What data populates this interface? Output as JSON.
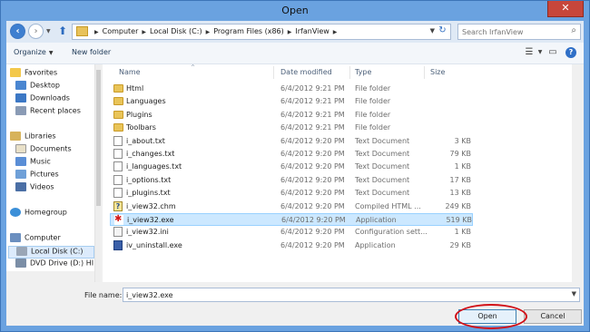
{
  "window": {
    "title": "Open",
    "close_glyph": "✕"
  },
  "address": {
    "crumbs": [
      "Computer",
      "Local Disk (C:)",
      "Program Files (x86)",
      "IrfanView"
    ],
    "search_placeholder": "Search IrfanView"
  },
  "toolbar": {
    "organize_label": "Organize",
    "new_folder_label": "New folder"
  },
  "nav": {
    "favorites": {
      "label": "Favorites",
      "items": [
        "Desktop",
        "Downloads",
        "Recent places"
      ]
    },
    "libraries": {
      "label": "Libraries",
      "items": [
        "Documents",
        "Music",
        "Pictures",
        "Videos"
      ]
    },
    "homegroup": {
      "label": "Homegroup"
    },
    "computer": {
      "label": "Computer",
      "items": [
        "Local Disk (C:)",
        "DVD Drive (D:) HI"
      ]
    }
  },
  "columns": {
    "name": "Name",
    "date": "Date modified",
    "type": "Type",
    "size": "Size"
  },
  "files": [
    {
      "name": "Html",
      "date": "6/4/2012 9:21 PM",
      "type": "File folder",
      "size": "",
      "icon": "folder-icon"
    },
    {
      "name": "Languages",
      "date": "6/4/2012 9:21 PM",
      "type": "File folder",
      "size": "",
      "icon": "folder-icon"
    },
    {
      "name": "Plugins",
      "date": "6/4/2012 9:21 PM",
      "type": "File folder",
      "size": "",
      "icon": "folder-icon"
    },
    {
      "name": "Toolbars",
      "date": "6/4/2012 9:21 PM",
      "type": "File folder",
      "size": "",
      "icon": "folder-icon"
    },
    {
      "name": "i_about.txt",
      "date": "6/4/2012 9:20 PM",
      "type": "Text Document",
      "size": "3 KB",
      "icon": "text-file-icon"
    },
    {
      "name": "i_changes.txt",
      "date": "6/4/2012 9:20 PM",
      "type": "Text Document",
      "size": "79 KB",
      "icon": "text-file-icon"
    },
    {
      "name": "i_languages.txt",
      "date": "6/4/2012 9:20 PM",
      "type": "Text Document",
      "size": "1 KB",
      "icon": "text-file-icon"
    },
    {
      "name": "i_options.txt",
      "date": "6/4/2012 9:20 PM",
      "type": "Text Document",
      "size": "17 KB",
      "icon": "text-file-icon"
    },
    {
      "name": "i_plugins.txt",
      "date": "6/4/2012 9:20 PM",
      "type": "Text Document",
      "size": "13 KB",
      "icon": "text-file-icon"
    },
    {
      "name": "i_view32.chm",
      "date": "6/4/2012 9:20 PM",
      "type": "Compiled HTML ...",
      "size": "249 KB",
      "icon": "help-file-icon"
    },
    {
      "name": "i_view32.exe",
      "date": "6/4/2012 9:20 PM",
      "type": "Application",
      "size": "519 KB",
      "icon": "irfanview-app-icon",
      "selected": true
    },
    {
      "name": "i_view32.ini",
      "date": "6/4/2012 9:20 PM",
      "type": "Configuration sett...",
      "size": "1 KB",
      "icon": "config-file-icon"
    },
    {
      "name": "iv_uninstall.exe",
      "date": "6/4/2012 9:20 PM",
      "type": "Application",
      "size": "29 KB",
      "icon": "uninstall-app-icon"
    }
  ],
  "bottom": {
    "filename_label": "File name:",
    "filename_value": "i_view32.exe",
    "open_label": "Open",
    "cancel_label": "Cancel"
  },
  "colors": {
    "highlight_circle": "#d10f16",
    "selection": "#cce8ff"
  }
}
